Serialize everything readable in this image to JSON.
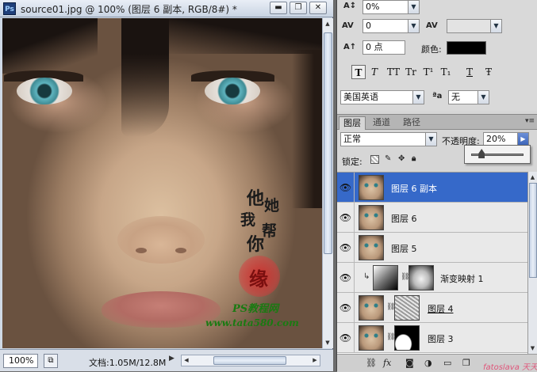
{
  "document": {
    "title": "source01.jpg @ 100% (图层 6 副本, RGB/8#) *",
    "app_icon": "Ps",
    "buttons": {
      "minimize": "▬",
      "restore": "❐",
      "close": "✕"
    },
    "artwork": {
      "calligraphy": [
        "他",
        "她",
        "我",
        "帮",
        "你"
      ],
      "seal_char": "缘",
      "watermark_site_name": "PS教程网",
      "watermark_url": "www.tata580.com"
    }
  },
  "statusbar": {
    "zoom": "100%",
    "doc_size": "文档:1.05M/12.8M",
    "prev_arrow": "◀",
    "next_arrow": "▶"
  },
  "character_panel": {
    "baseline_shift": "0%",
    "kerning": "0",
    "baseline": "0 点",
    "color_label": "颜色:",
    "color_value": "#000000",
    "style_buttons": [
      "T",
      "T",
      "TT",
      "Tr",
      "T¹",
      "T₁",
      "T",
      "Ŧ"
    ],
    "language": "美国英语",
    "antialias_label": "ªa",
    "antialias": "无"
  },
  "layers_panel": {
    "tabs": [
      "图层",
      "通道",
      "路径"
    ],
    "active_tab": "图层",
    "blend_mode": "正常",
    "opacity_label": "不透明度:",
    "opacity": "20%",
    "lock_label": "锁定:",
    "opacity_slider_fraction": 0.2,
    "layers": [
      {
        "name": "图层 6 副本",
        "selected": true,
        "visible": true,
        "type": "image"
      },
      {
        "name": "图层 6",
        "selected": false,
        "visible": true,
        "type": "image"
      },
      {
        "name": "图层 5",
        "selected": false,
        "visible": true,
        "type": "image"
      },
      {
        "name": "渐变映射 1",
        "selected": false,
        "visible": true,
        "type": "adjustment"
      },
      {
        "name": "图层 4",
        "selected": false,
        "visible": true,
        "type": "masked-scribble"
      },
      {
        "name": "图层 3",
        "selected": false,
        "visible": true,
        "type": "masked-black"
      }
    ],
    "bottom_icons": [
      "link-icon",
      "fx-icon",
      "mask-icon",
      "adjustment-icon",
      "folder-icon",
      "new-layer-icon",
      "trash-icon"
    ],
    "corner_text": "fatoslava 天天"
  },
  "colors": {
    "selected_layer": "#3669c9",
    "watermark_green": "#1a7a12",
    "seal_red": "#d62828"
  }
}
